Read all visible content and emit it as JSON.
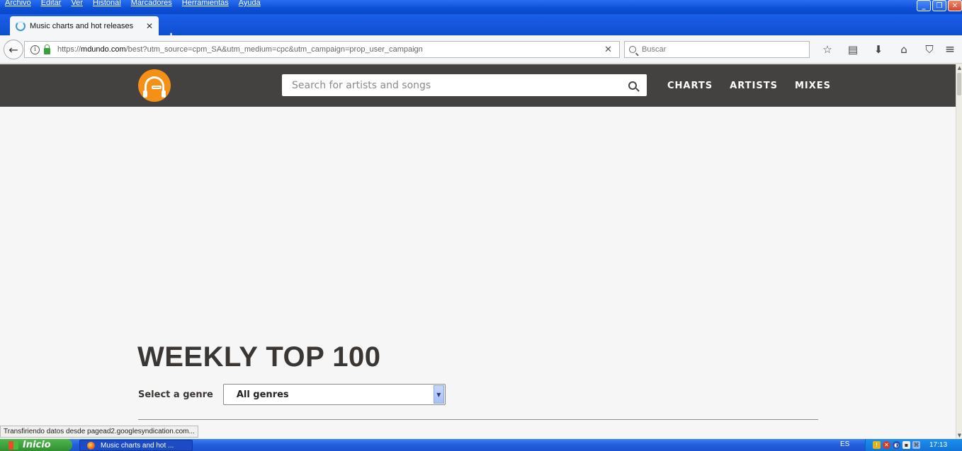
{
  "window": {
    "menu": [
      "Archivo",
      "Editar",
      "Ver",
      "Historial",
      "Marcadores",
      "Herramientas",
      "Ayuda"
    ],
    "minimize_glyph": "_",
    "maximize_glyph": "❐",
    "close_glyph": "✕"
  },
  "tab": {
    "title": "Music charts and hot releases",
    "close_glyph": "✕",
    "new_tab_glyph": "+"
  },
  "navbar": {
    "back_glyph": "←",
    "info_glyph": "i",
    "url_prefix": "https://",
    "url_host": "mdundo.com",
    "url_path": "/best?utm_source=cpm_SA&utm_medium=cpc&utm_campaign=prop_user_campaign",
    "url_clear_glyph": "✕",
    "search_placeholder": "Buscar",
    "toolbar_icons": [
      {
        "name": "bookmark-star-icon",
        "glyph": "☆"
      },
      {
        "name": "reading-list-icon",
        "glyph": "▤"
      },
      {
        "name": "downloads-icon",
        "glyph": "⬇"
      },
      {
        "name": "home-icon",
        "glyph": "⌂"
      },
      {
        "name": "pocket-icon",
        "glyph": "⛉"
      }
    ],
    "menu_glyph": "≡"
  },
  "site": {
    "search_placeholder": "Search for artists and songs",
    "nav": [
      "CHARTS",
      "ARTISTS",
      "MIXES"
    ],
    "accent_color": "#f39015",
    "header_color": "#444240"
  },
  "main": {
    "heading": "WEEKLY TOP 100",
    "genre_label": "Select a genre",
    "genre_selected": "All genres",
    "dropdown_glyph": "▼"
  },
  "status": {
    "text": "Transfiriendo datos desde pagead2.googlesyndication.com..."
  },
  "scrollbar": {
    "up_glyph": "▲",
    "down_glyph": "▼"
  },
  "taskbar": {
    "start_label": "Inicio",
    "task_label": "Music charts and hot ...",
    "language": "ES",
    "tray_icons": [
      {
        "name": "security-shield-icon",
        "glyph": "!"
      },
      {
        "name": "antivirus-icon",
        "glyph": "✕"
      },
      {
        "name": "app-tray-icon",
        "glyph": "◐"
      },
      {
        "name": "update-tray-icon",
        "glyph": "▪"
      },
      {
        "name": "network-icon",
        "glyph": "⌘"
      }
    ],
    "clock": "17:13"
  }
}
